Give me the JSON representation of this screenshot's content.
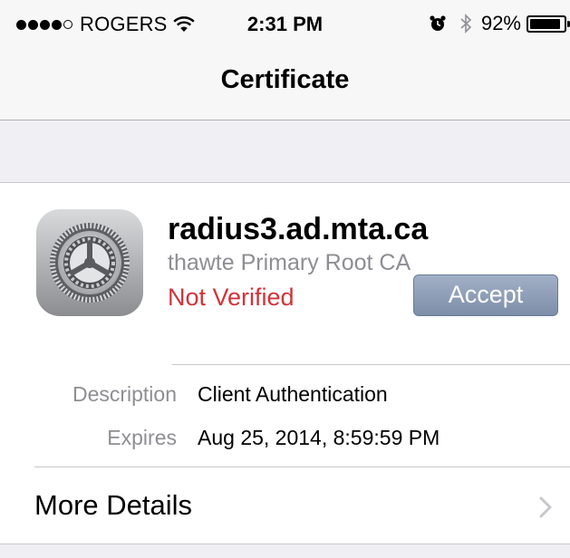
{
  "status_bar": {
    "carrier": "ROGERS",
    "time": "2:31 PM",
    "battery_percent": "92%",
    "battery_level": 0.92,
    "signal_bars_filled": 4,
    "signal_bars_total": 5,
    "icons": [
      "signal-dots-icon",
      "wifi-icon",
      "alarm-icon",
      "bluetooth-icon",
      "battery-icon"
    ]
  },
  "nav": {
    "title": "Certificate"
  },
  "certificate": {
    "name": "radius3.ad.mta.ca",
    "issuer": "thawte Primary Root CA",
    "status": "Not Verified",
    "accept_label": "Accept",
    "icon": "settings-gear-icon"
  },
  "details": [
    {
      "label": "Description",
      "value": "Client Authentication"
    },
    {
      "label": "Expires",
      "value": "Aug 25, 2014, 8:59:59 PM"
    }
  ],
  "more_details": {
    "label": "More Details",
    "icon": "chevron-right-icon"
  },
  "colors": {
    "status_red": "#d0333a",
    "accept_button": "#8c9bb4",
    "secondary_text": "#8e8e93",
    "nav_bg": "#f7f7f8",
    "group_bg": "#efeff4"
  }
}
